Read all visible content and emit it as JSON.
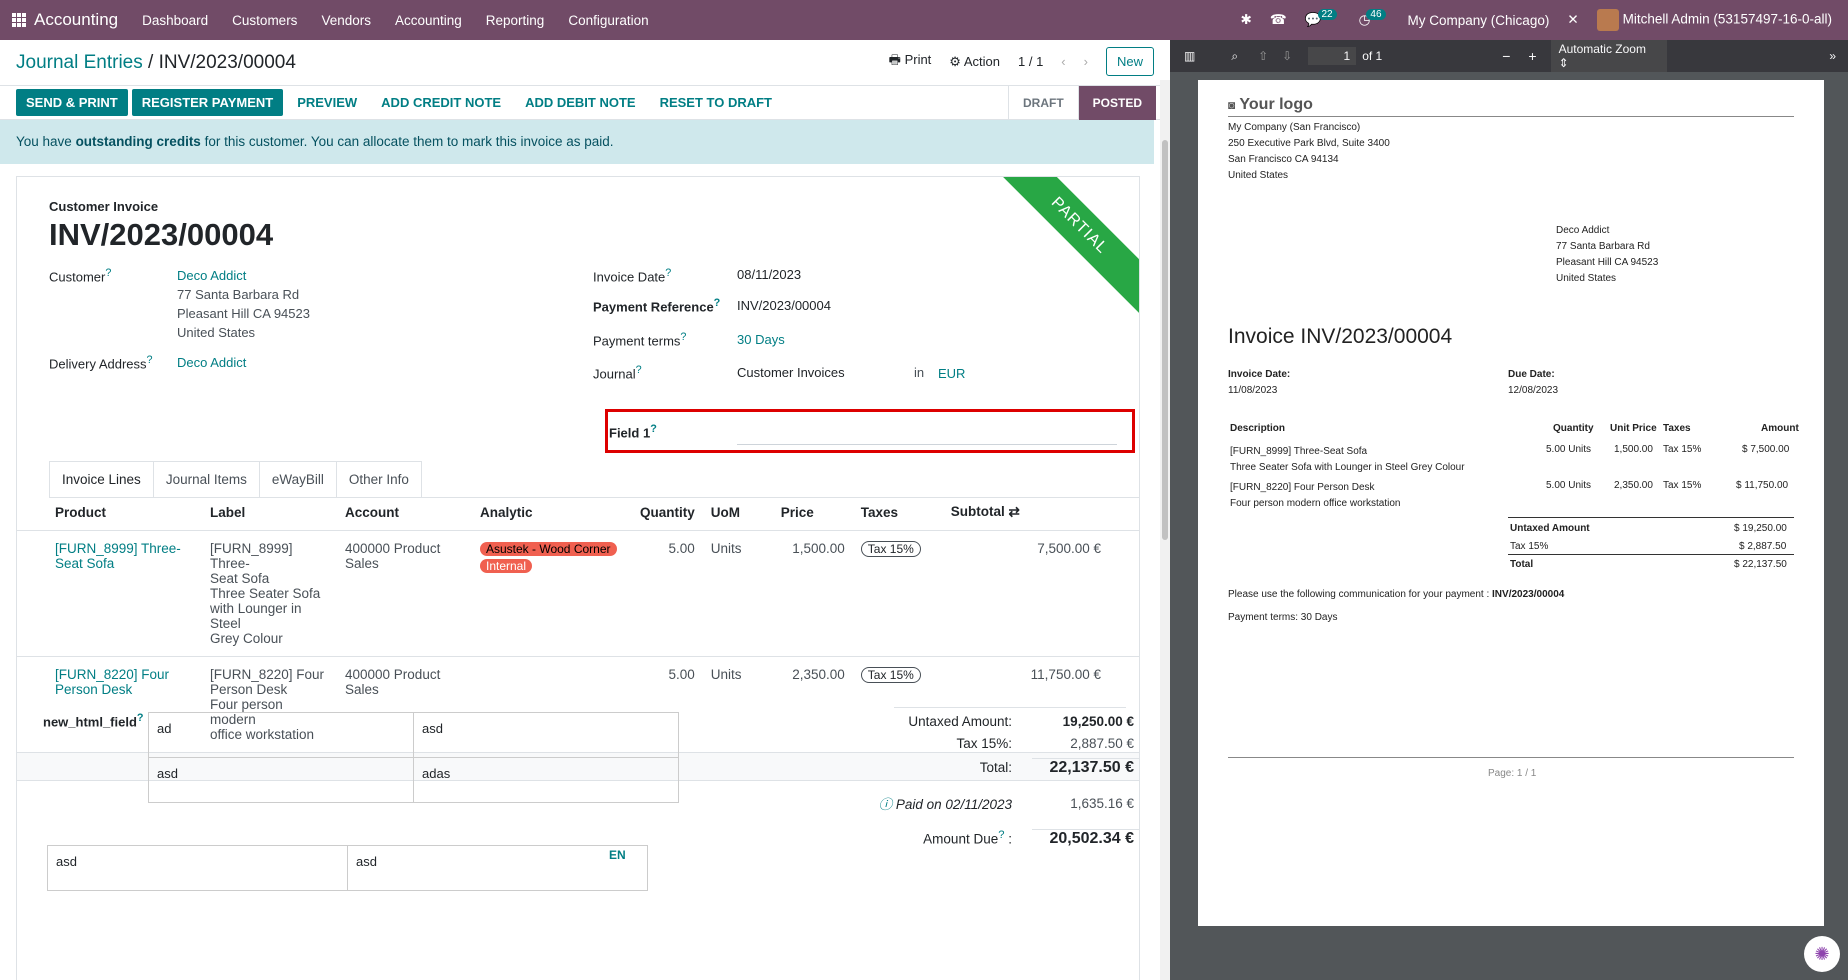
{
  "topbar": {
    "brand": "Accounting",
    "menu": [
      "Dashboard",
      "Customers",
      "Vendors",
      "Accounting",
      "Reporting",
      "Configuration"
    ],
    "chat_count": "22",
    "activity_count": "46",
    "company": "My Company (Chicago)",
    "user": "Mitchell Admin (53157497-16-0-all)"
  },
  "breadcrumb": {
    "parent": "Journal Entries",
    "separator": "/",
    "current": "INV/2023/00004"
  },
  "cp": {
    "print": "Print",
    "action": "Action",
    "pager": "1 / 1",
    "new": "New"
  },
  "status_buttons": [
    "SEND & PRINT",
    "REGISTER PAYMENT",
    "PREVIEW",
    "ADD CREDIT NOTE",
    "ADD DEBIT NOTE",
    "RESET TO DRAFT"
  ],
  "stages": [
    "DRAFT",
    "POSTED"
  ],
  "alert": {
    "pre": "You have ",
    "bold": "outstanding credits",
    "post": " for this customer. You can allocate them to mark this invoice as paid."
  },
  "form": {
    "type": "Customer Invoice",
    "number": "INV/2023/00004",
    "ribbon": "PARTIAL",
    "customer_label": "Customer",
    "customer": "Deco Addict",
    "addr1": "77 Santa Barbara Rd",
    "addr2": "Pleasant Hill CA 94523",
    "addr3": "United States",
    "delivery_label": "Delivery Address",
    "delivery": "Deco Addict",
    "invoice_date_label": "Invoice Date",
    "invoice_date": "08/11/2023",
    "payref_label": "Payment Reference",
    "payref": "INV/2023/00004",
    "terms_label": "Payment terms",
    "terms": "30 Days",
    "journal_label": "Journal",
    "journal": "Customer Invoices",
    "in": "in",
    "currency": "EUR",
    "field1_label": "Field 1",
    "help": "?"
  },
  "tabs": [
    "Invoice Lines",
    "Journal Items",
    "eWayBill",
    "Other Info"
  ],
  "columns": [
    "Product",
    "Label",
    "Account",
    "Analytic",
    "Quantity",
    "UoM",
    "Price",
    "Taxes",
    "Subtotal"
  ],
  "lines": [
    {
      "product": "[FURN_8999] Three-Seat Sofa",
      "label1": "[FURN_8999] Three-",
      "label2": "Seat Sofa",
      "label3": "Three Seater Sofa",
      "label4": "with Lounger in Steel",
      "label5": "Grey Colour",
      "account": "400000 Product Sales",
      "tag1": "Asustek - Wood Corner",
      "tag2": "Internal",
      "qty": "5.00",
      "uom": "Units",
      "price": "1,500.00",
      "tax": "Tax 15%",
      "subtotal": "7,500.00 €"
    },
    {
      "product": "[FURN_8220] Four Person Desk",
      "label1": "[FURN_8220] Four",
      "label2": "Person Desk",
      "label3": "Four person modern",
      "label4": "office workstation",
      "label5": "",
      "account": "400000 Product Sales",
      "tag1": "",
      "tag2": "",
      "qty": "5.00",
      "uom": "Units",
      "price": "2,350.00",
      "tax": "Tax 15%",
      "subtotal": "11,750.00 €"
    }
  ],
  "html_field": {
    "label": "new_html_field",
    "cells": [
      "ad",
      "asd",
      "asd",
      "adas"
    ],
    "row2": [
      "asd",
      "asd"
    ],
    "lang": "EN"
  },
  "totals": {
    "untaxed_label": "Untaxed Amount:",
    "untaxed": "19,250.00 €",
    "tax_label": "Tax 15%:",
    "tax": "2,887.50 €",
    "total_label": "Total:",
    "total": "22,137.50 €",
    "paid_label": "Paid on 02/11/2023",
    "paid": "1,635.16 €",
    "due_label": "Amount Due",
    "due": "20,502.34 €"
  },
  "pdf": {
    "page_input": "1",
    "page_of": "of 1",
    "zoom": "Automatic Zoom",
    "logo": "Your logo",
    "company": "My Company (San Francisco)",
    "c1": "250 Executive Park Blvd, Suite 3400",
    "c2": "San Francisco CA 94134",
    "c3": "United States",
    "cust": "Deco Addict",
    "cu1": "77 Santa Barbara Rd",
    "cu2": "Pleasant Hill CA 94523",
    "cu3": "United States",
    "title": "Invoice INV/2023/00004",
    "inv_date_label": "Invoice Date:",
    "inv_date": "11/08/2023",
    "due_date_label": "Due Date:",
    "due_date": "12/08/2023",
    "cols": [
      "Description",
      "Quantity",
      "Unit Price",
      "Taxes",
      "Amount"
    ],
    "rows": [
      {
        "d1": "[FURN_8999] Three-Seat Sofa",
        "d2": "Three Seater Sofa with Lounger in Steel Grey Colour",
        "q": "5.00 Units",
        "u": "1,500.00",
        "t": "Tax 15%",
        "a": "$ 7,500.00"
      },
      {
        "d1": "[FURN_8220] Four Person Desk",
        "d2": "Four person modern office workstation",
        "q": "5.00 Units",
        "u": "2,350.00",
        "t": "Tax 15%",
        "a": "$ 11,750.00"
      }
    ],
    "untaxed_label": "Untaxed Amount",
    "untaxed": "$ 19,250.00",
    "tax_label": "Tax 15%",
    "tax": "$ 2,887.50",
    "total_label": "Total",
    "total": "$ 22,137.50",
    "comm_pre": "Please use the following communication for your payment : ",
    "comm": "INV/2023/00004",
    "terms": "Payment terms: 30 Days",
    "footer": "Page: 1 / 1"
  }
}
